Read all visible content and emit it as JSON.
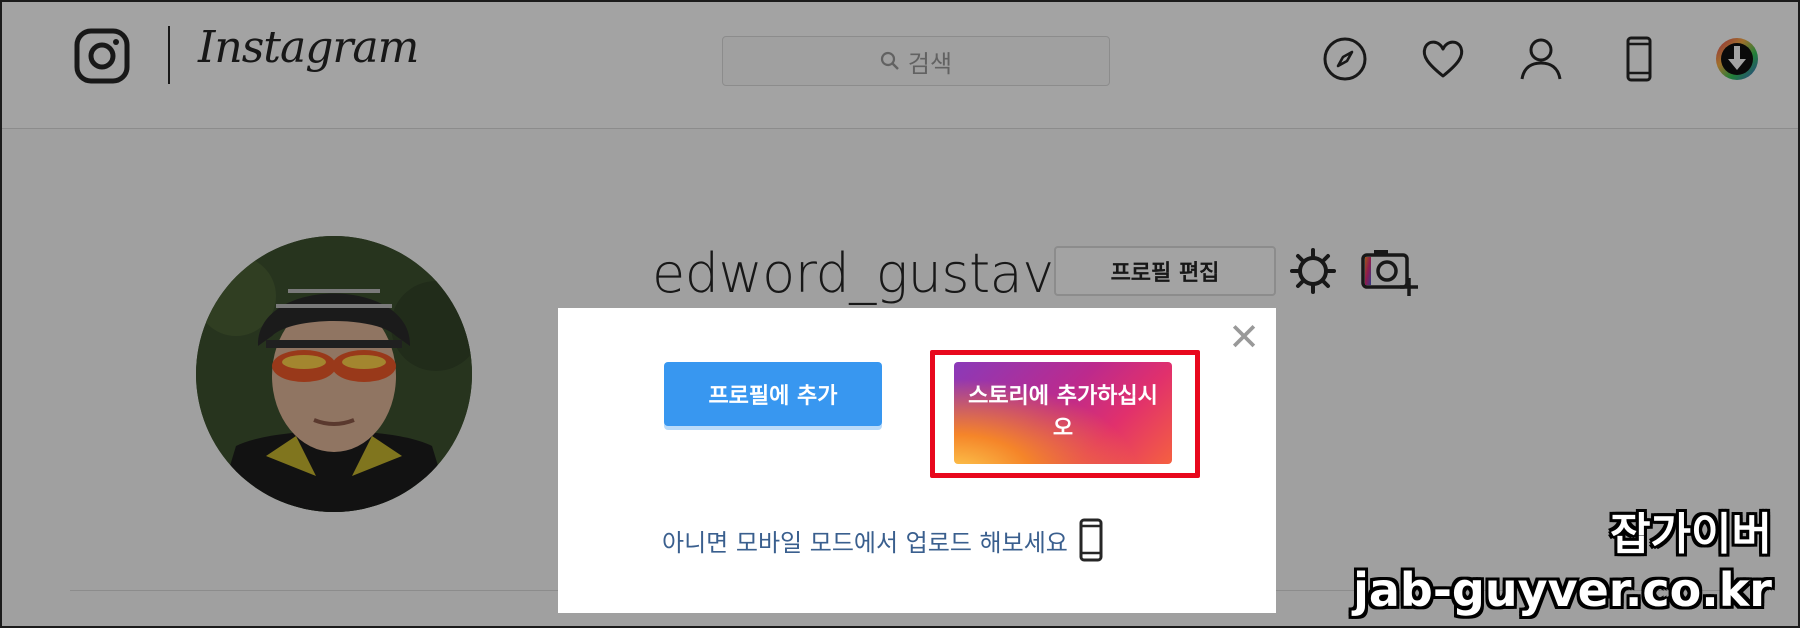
{
  "header": {
    "wordmark": "Instagram",
    "search_placeholder": "검색",
    "nav_icons": [
      "compass-icon",
      "heart-icon",
      "person-icon",
      "mobile-phone-icon",
      "download-icon"
    ]
  },
  "profile": {
    "username": "edword_gustav",
    "edit_button": "프로필 편집"
  },
  "modal": {
    "add_to_profile": "프로필에 추가",
    "add_to_story": "스토리에 추가하십시오",
    "mobile_hint": "아니면 모바일 모드에서 업로드 해보세요",
    "close_symbol": "✕"
  },
  "watermark": {
    "name": "잡가이버",
    "site": "jab-guyver.co.kr"
  },
  "colors": {
    "primary_blue": "#3897f0",
    "highlight_red": "#e8081d",
    "story_gradient": [
      "#8a3ab9",
      "#bc2a8d",
      "#e1306c",
      "#f56040",
      "#fdcc50"
    ]
  }
}
